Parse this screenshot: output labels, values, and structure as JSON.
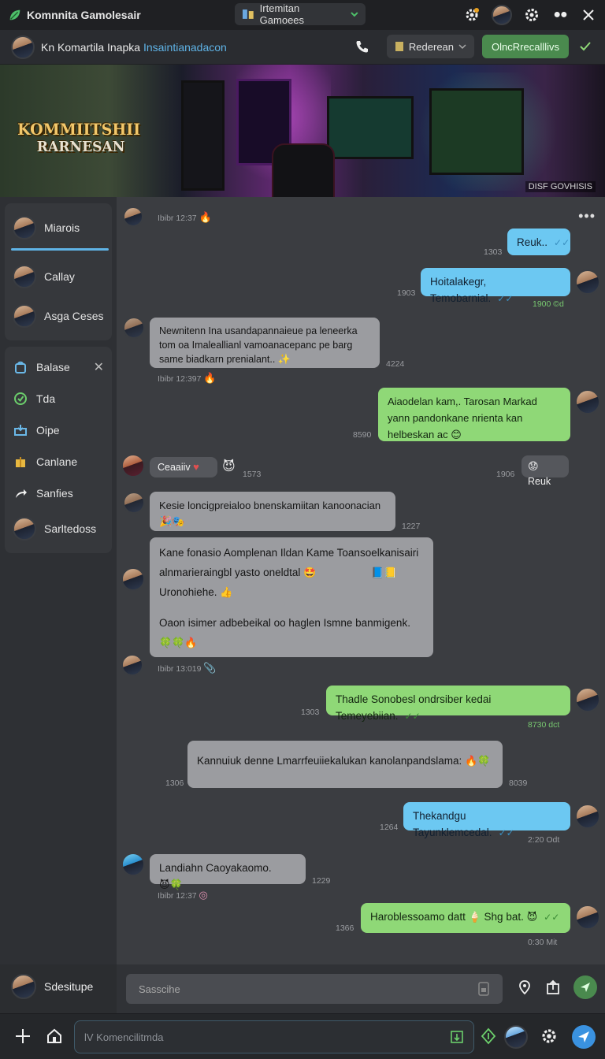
{
  "topbar": {
    "brand": "Komnnita Gamolesair",
    "server_select": "Irtemitan Gamoees"
  },
  "channel": {
    "title_main": "Kn Komartila Inapka ",
    "title_sub": "Insaintianadacon",
    "dropdown_label": "Rederean",
    "green_button": "OlncRrecalllivs"
  },
  "banner": {
    "logo_line1": "KOMMIITSHII",
    "logo_line2": "RARNESAN",
    "caption": "DISF GOVHISIS"
  },
  "sidebar": {
    "group1": [
      {
        "label": "Miarois"
      },
      {
        "label": "Callay"
      },
      {
        "label": "Asga Ceses"
      }
    ],
    "group2": [
      {
        "label": "Balase"
      },
      {
        "label": "Tda"
      },
      {
        "label": "Oipe"
      },
      {
        "label": "Canlane"
      },
      {
        "label": "Sanfies"
      },
      {
        "label": "Sarltedoss"
      }
    ],
    "me": "Sdesitupe"
  },
  "messages": {
    "m0_meta": "Ibibr 12:37",
    "m1_text": "Reuk..",
    "m1_time": "1303",
    "m2_text": "Hoitalakegr, Temobarnial.",
    "m2_time": "1903",
    "m2_meta": "1900 ©d",
    "m3_text": "Newnitenn Ina usandapannaieue pa leneerka tom oa Imaleallianl vamoanacepanc pe barg same biadkarn prenialant..",
    "m3_time": "4224",
    "m3_meta": "Ibibr 12:397",
    "m4_text": "Aiaodelan kam,. Tarosan Markad yann pandonkane nrienta kan helbeskan ac",
    "m4_time": "8590",
    "m5_text": "Ceaaiiv",
    "m5_time": "1573",
    "m5r_text": "Reuk",
    "m5r_time": "1906",
    "m6_text": "Kesie loncigpreialoo bnenskamiitan kanoonacian",
    "m6_time": "1227",
    "m7_line1": "Kane fonasio Aomplenan Ildan Kame Toansoelkanisairi",
    "m7_line2": "alnmarieraingbl yasto oneldtal",
    "m7_line3": "Uronohiehe.",
    "m7_line4": "Oaon isimer adbebeikal oo haglen Ismne banmigenk.",
    "m7_meta": "Ibibr 13:019",
    "m8_text": "Thadle Sonobesl ondrsiber kedai Temeyebiian.",
    "m8_time": "1303",
    "m8_meta": "8730 dct",
    "m9_text": "Kannuiuk denne Lmarrfeuiiekalukan kanolanpandslama:",
    "m9_time_left": "1306",
    "m9_time_right": "8039",
    "m10_text": "Thekandgu Tayunklemcedal.",
    "m10_time": "1264",
    "m10_meta": "2:20 Odt",
    "m11_text": "Landiahn Caoyakaomo.",
    "m11_time": "1229",
    "m11_meta": "Ibibr 12:37",
    "m12_text": "Haroblessoamo datt",
    "m12_text2": "Shg bat.",
    "m12_time": "1366",
    "m12_meta": "0:30 Mit"
  },
  "composer": {
    "search_placeholder": "Sasscihe"
  },
  "bottombar": {
    "input_placeholder": "lV Komencilitmda"
  },
  "colors": {
    "accent_blue": "#5fb3e6",
    "bubble_blue": "#6cc8f2",
    "bubble_green": "#8fd877",
    "bubble_gray": "#9b9ca0",
    "brand_green": "#4a8a4e"
  }
}
